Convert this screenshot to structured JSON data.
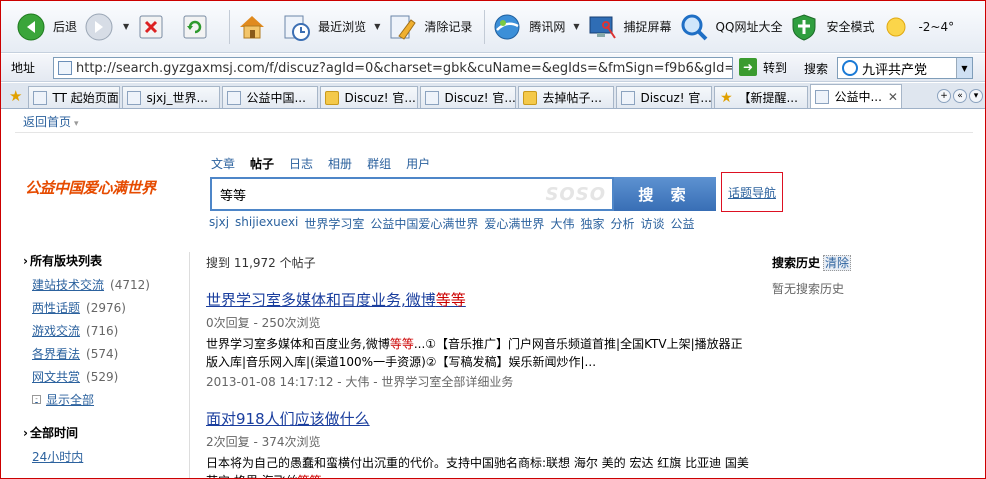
{
  "toolbar": {
    "back": "后退",
    "recent": "最近浏览",
    "clear": "清除记录",
    "tencent": "腾讯网",
    "capture": "捕捉屏幕",
    "qqnav": "QQ网址大全",
    "safe": "安全模式",
    "weather": "-2~4°"
  },
  "address": {
    "label": "地址",
    "url": "http://search.gyzgaxmsj.com/f/discuz?agId=0&charset=gbk&cuName=&egIds=&fmSign=f9b6&gId=7&",
    "go": "转到",
    "search_label": "搜索",
    "search_value": "九评共产党"
  },
  "tabs": [
    {
      "label": "TT 起始页面",
      "icon": "page"
    },
    {
      "label": "sjxj_世界...",
      "icon": "page"
    },
    {
      "label": "公益中国...",
      "icon": "page"
    },
    {
      "label": "Discuz! 官...",
      "icon": "discuz"
    },
    {
      "label": "Discuz! 官...",
      "icon": "page"
    },
    {
      "label": "去掉帖子...",
      "icon": "discuz"
    },
    {
      "label": "Discuz! 官...",
      "icon": "page"
    },
    {
      "label": "【新提醒...",
      "icon": "star"
    },
    {
      "label": "公益中...",
      "icon": "page",
      "active": true
    }
  ],
  "page": {
    "back_home": "返回首页",
    "logo": "公益中国爱心满世界",
    "search_tabs": [
      "文章",
      "帖子",
      "日志",
      "相册",
      "群组",
      "用户"
    ],
    "active_tab": "帖子",
    "query": "等等",
    "search_watermark": "SOSO",
    "search_button": "搜 索",
    "topic_nav": "话题导航",
    "hotwords": [
      "sjxj",
      "shijiexuexi",
      "世界学习室",
      "公益中国爱心满世界",
      "爱心满世界",
      "大伟",
      "独家",
      "分析",
      "访谈",
      "公益"
    ]
  },
  "sidebar": {
    "forums_title": "所有版块列表",
    "forums": [
      {
        "name": "建站技术交流",
        "count": "(4712)"
      },
      {
        "name": "两性话题",
        "count": "(2976)"
      },
      {
        "name": "游戏交流",
        "count": "(716)"
      },
      {
        "name": "各界看法",
        "count": "(574)"
      },
      {
        "name": "网文共赏",
        "count": "(529)"
      }
    ],
    "show_all": "显示全部",
    "time_title": "全部时间",
    "time_first": "24小时内"
  },
  "results": {
    "count_text": "搜到  11,972 个帖子",
    "items": [
      {
        "title_pre": "世界学习室多媒体和百度业务,微博",
        "title_hl": "等等",
        "meta": "0次回复 - 250次浏览",
        "desc_pre": "世界学习室多媒体和百度业务,微博",
        "desc_hl": "等等",
        "desc_post": "...①【音乐推广】门户网音乐频道首推|全国KTV上架|播放器正版入库|音乐网入库|(渠道100%一手资源)②【写稿发稿】娱乐新闻炒作|...",
        "foot": "2013-01-08 14:17:12 - 大伟 - 世界学习室全部详细业务"
      },
      {
        "title_pre": "面对918人们应该做什么",
        "title_hl": "",
        "meta": "2次回复 - 374次浏览",
        "desc_pre": "日本将为自己的愚蠢和蛮横付出沉重的代价。支持中国驰名商标:联想 海尔 美的 宏达 红旗 比亚迪 国美 苏宁 格里 海飞丝",
        "desc_hl": "等等",
        "desc_post": "",
        "foot": ""
      }
    ]
  },
  "history": {
    "title": "搜索历史",
    "clear": "清除",
    "empty": "暂无搜索历史"
  }
}
